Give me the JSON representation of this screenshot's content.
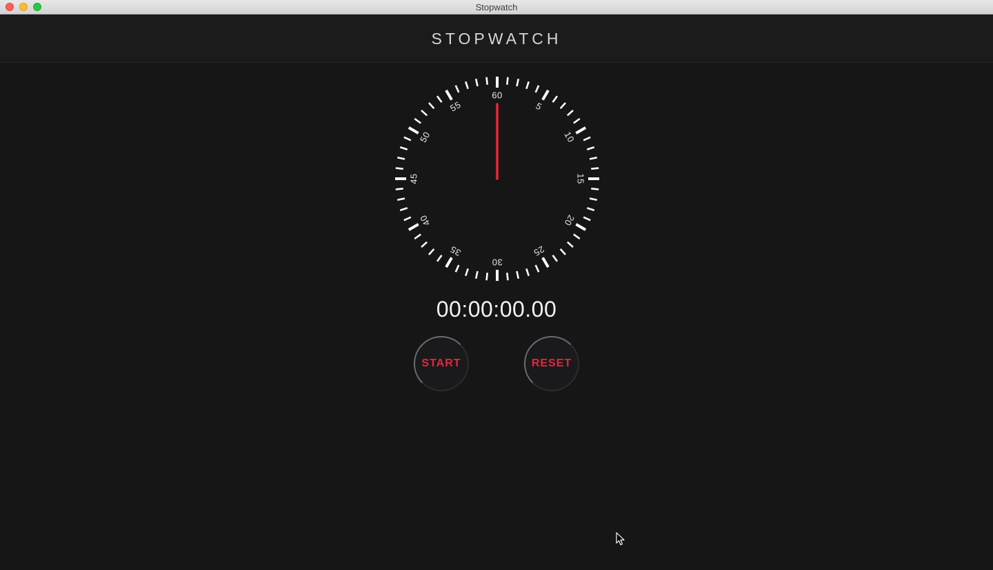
{
  "window": {
    "title": "Stopwatch"
  },
  "header": {
    "title": "STOPWATCH"
  },
  "dial": {
    "labels": [
      "60",
      "5",
      "10",
      "15",
      "20",
      "25",
      "30",
      "35",
      "40",
      "45",
      "50",
      "55"
    ],
    "hand_seconds": 0,
    "hand_color": "#e8263a",
    "tick_color": "#ffffff"
  },
  "timer": {
    "display": "00:00:00.00"
  },
  "controls": {
    "start_label": "START",
    "reset_label": "RESET",
    "accent_color": "#e8263a"
  },
  "icons": {
    "cursor": "pointer-arrow-icon"
  }
}
